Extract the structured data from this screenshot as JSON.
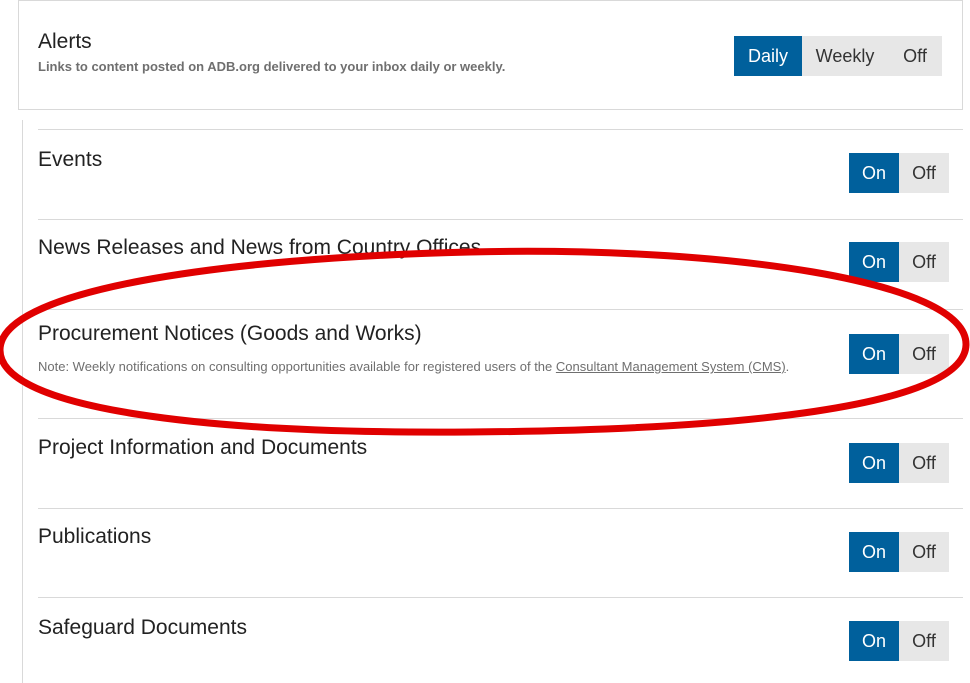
{
  "alerts": {
    "title": "Alerts",
    "subtitle": "Links to content posted on ADB.org delivered to your inbox daily or weekly.",
    "frequency_options": [
      "Daily",
      "Weekly",
      "Off"
    ],
    "selected": "Daily"
  },
  "subscriptions": [
    {
      "title": "Events",
      "on_label": "On",
      "off_label": "Off",
      "state": "On"
    },
    {
      "title": "News Releases and News from Country Offices",
      "on_label": "On",
      "off_label": "Off",
      "state": "On"
    },
    {
      "title": "Procurement Notices (Goods and Works)",
      "note_prefix": "Note: Weekly notifications on consulting opportunities available for registered users of the ",
      "note_link": "Consultant Management System (CMS)",
      "note_suffix": ".",
      "on_label": "On",
      "off_label": "Off",
      "state": "On"
    },
    {
      "title": "Project Information and Documents",
      "on_label": "On",
      "off_label": "Off",
      "state": "On"
    },
    {
      "title": "Publications",
      "on_label": "On",
      "off_label": "Off",
      "state": "On"
    },
    {
      "title": "Safeguard Documents",
      "on_label": "On",
      "off_label": "Off",
      "state": "On"
    }
  ],
  "colors": {
    "active": "#00609c",
    "inactive": "#e7e7e7",
    "annotation": "#e00000"
  }
}
